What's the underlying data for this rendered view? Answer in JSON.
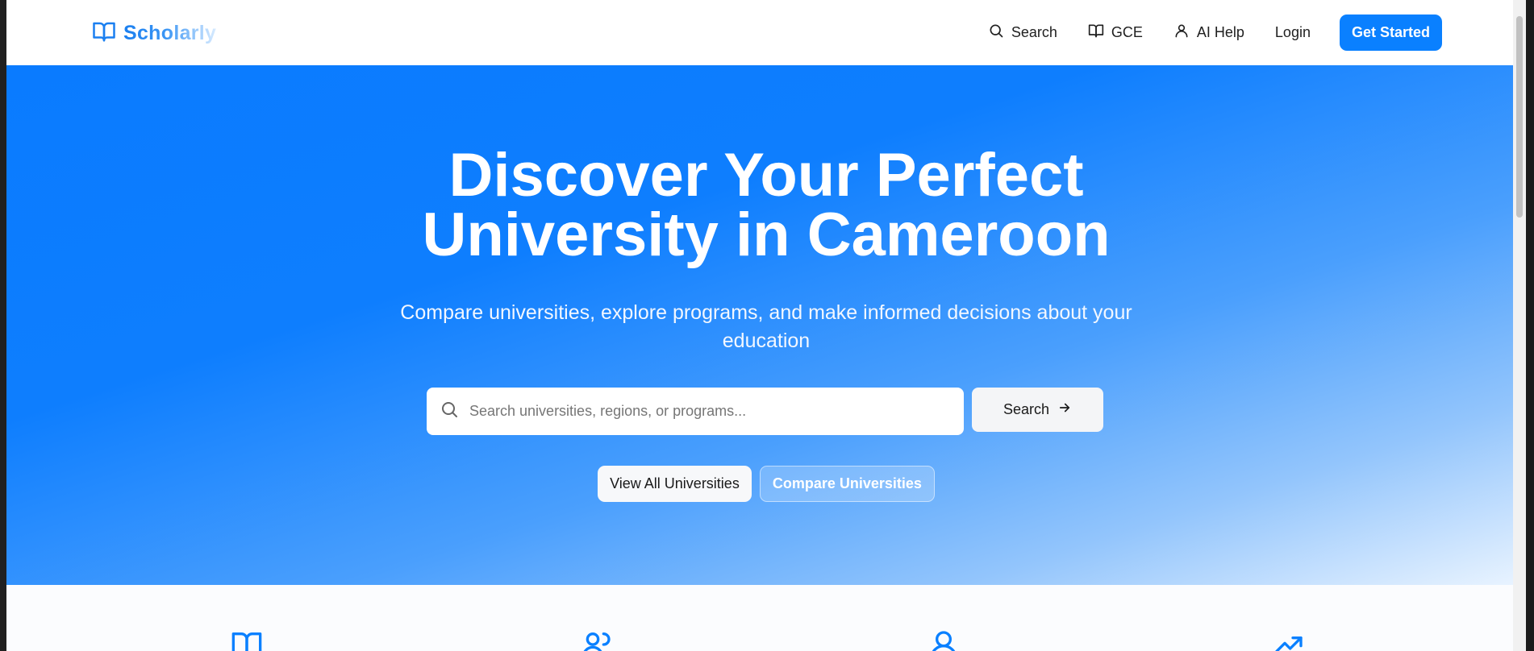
{
  "brand": {
    "name": "Scholarly",
    "icon": "book-open-icon",
    "color": "#1a7ff0"
  },
  "nav": {
    "items": [
      {
        "label": "Search",
        "icon": "search-icon"
      },
      {
        "label": "GCE",
        "icon": "book-open-icon"
      },
      {
        "label": "AI Help",
        "icon": "user-icon"
      },
      {
        "label": "Login",
        "icon": ""
      }
    ],
    "cta": "Get Started"
  },
  "hero": {
    "title_line1": "Discover Your Perfect",
    "title_line2": "University in Cameroon",
    "subtitle_line1": "Compare universities, explore programs, and make informed decisions about your",
    "subtitle_line2": "education",
    "search_placeholder": "Search universities, regions, or programs...",
    "search_value": "",
    "search_button": "Search",
    "secondary_buttons": [
      "View All Universities",
      "Compare Universities"
    ]
  },
  "features": {
    "icons": [
      "book-open-icon",
      "users-icon",
      "user-icon",
      "trending-up-icon"
    ]
  },
  "colors": {
    "primary": "#0a80ff",
    "hero_start": "#0a7bff",
    "hero_end": "#eaf4ff"
  }
}
